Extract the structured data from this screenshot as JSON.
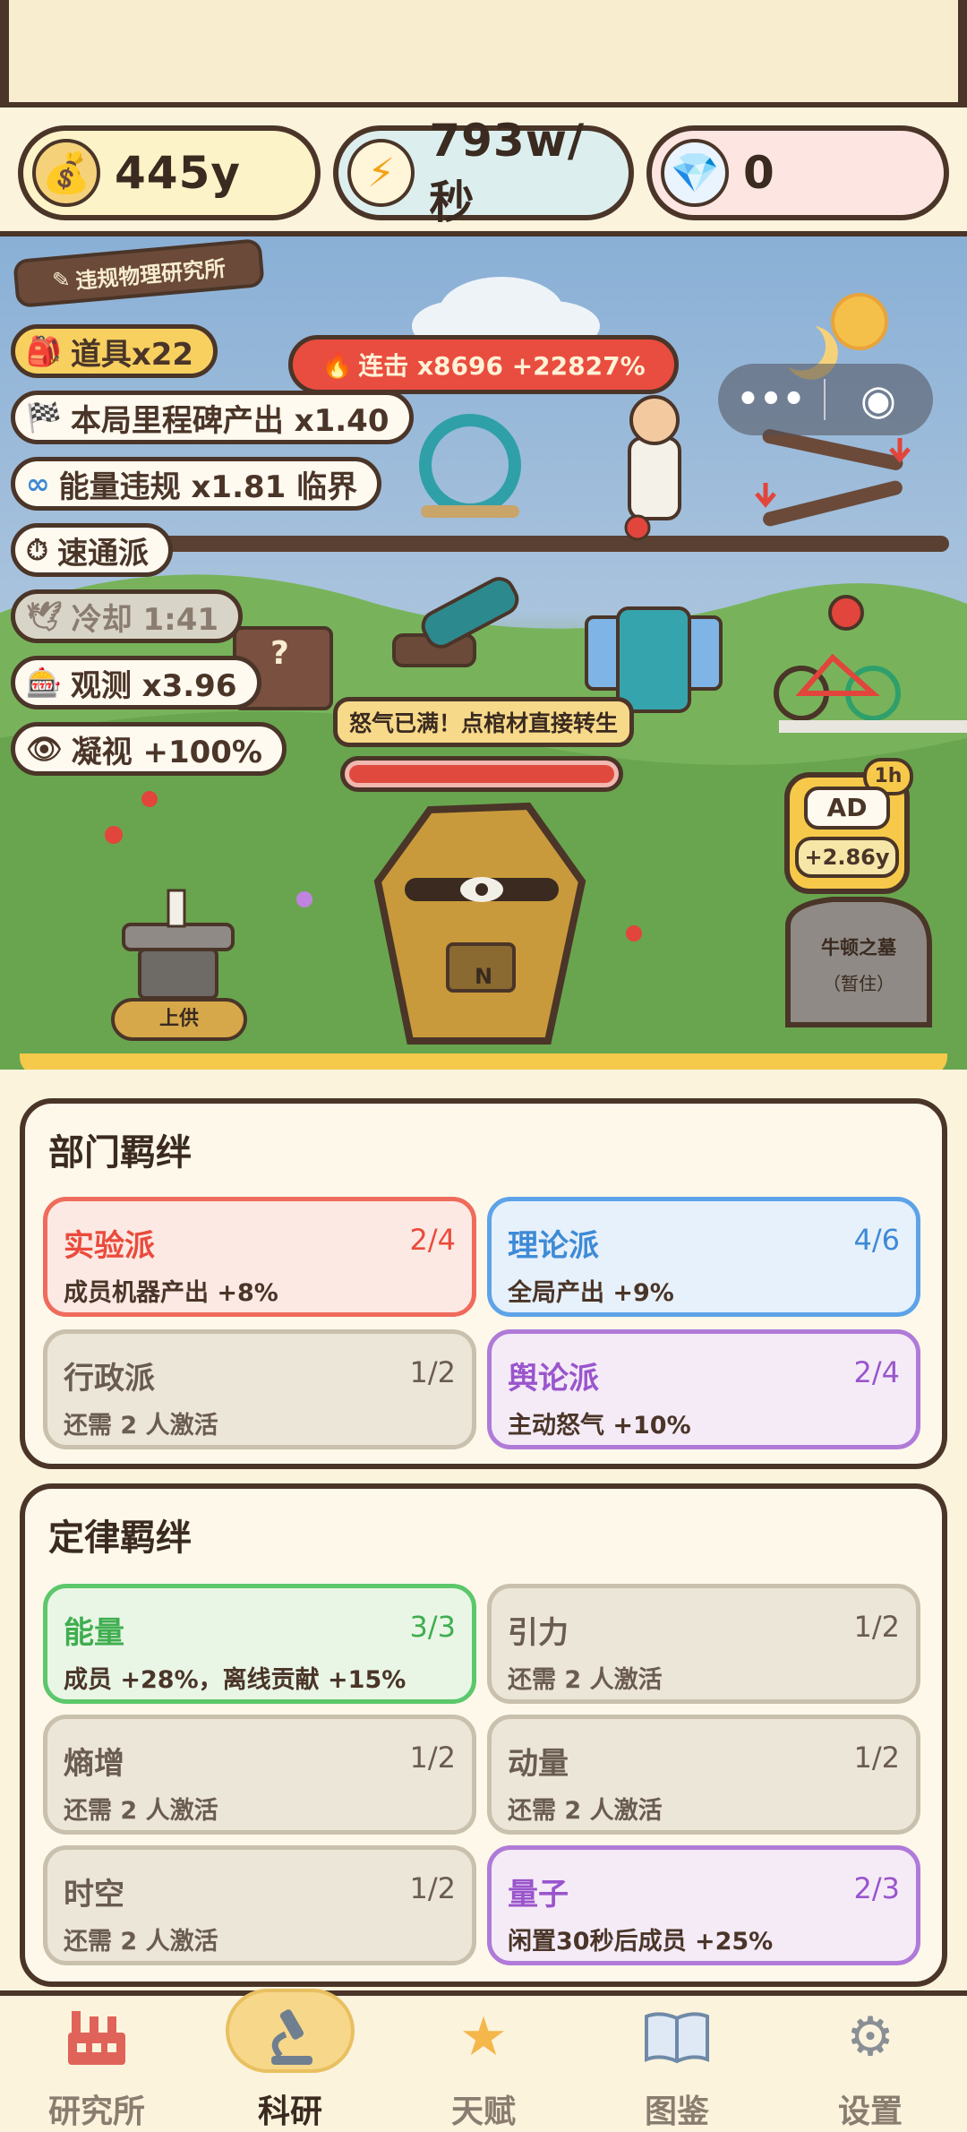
{
  "currency": {
    "money": "445y",
    "energy": "793w/秒",
    "gems": "0"
  },
  "scene": {
    "lab_sign": "违规物理研究所",
    "combo_text": "连击 x8696 +22827%",
    "rage_text": "怒气已满！点棺材直接转生",
    "coffin_letter": "N",
    "ad_label": "AD",
    "ad_timer": "1h",
    "ad_reward": "+2.86y",
    "offer_button": "上供",
    "tomb_name": "牛顿之墓",
    "tomb_status": "（暂住）",
    "question_mark": "?",
    "tags": [
      {
        "icon": "backpack-icon",
        "text": "道具x22"
      },
      {
        "icon": "checkered-flag-icon",
        "text": "本局里程碑产出 x1.40"
      },
      {
        "icon": "infinity-icon",
        "text": "能量违规 x1.81 临界"
      },
      {
        "icon": "stopwatch-icon",
        "text": "速通派"
      },
      {
        "icon": "dove-icon",
        "text": "冷却 1:41"
      },
      {
        "icon": "slot-machine-icon",
        "text": "观测 x3.96"
      },
      {
        "icon": "eye-icon",
        "text": "凝视 +100%"
      }
    ]
  },
  "department_bonds": {
    "title": "部门羁绊",
    "cards": [
      {
        "name": "实验派",
        "count": "2/4",
        "desc": "成员机器产出 +8%",
        "color": "#ea4b3c"
      },
      {
        "name": "理论派",
        "count": "4/6",
        "desc": "全局产出 +9%",
        "color": "#3e8ad6"
      },
      {
        "name": "行政派",
        "count": "1/2",
        "desc": "还需 2 人激活",
        "color": "#6a5c50"
      },
      {
        "name": "舆论派",
        "count": "2/4",
        "desc": "主动怒气 +10%",
        "color": "#9a55cc"
      }
    ]
  },
  "law_bonds": {
    "title": "定律羁绊",
    "cards": [
      {
        "name": "能量",
        "count": "3/3",
        "desc": "成员 +28%，离线贡献 +15%",
        "color": "#3fae4f"
      },
      {
        "name": "引力",
        "count": "1/2",
        "desc": "还需 2 人激活",
        "color": "#6a5c50"
      },
      {
        "name": "熵增",
        "count": "1/2",
        "desc": "还需 2 人激活",
        "color": "#6a5c50"
      },
      {
        "name": "动量",
        "count": "1/2",
        "desc": "还需 2 人激活",
        "color": "#6a5c50"
      },
      {
        "name": "时空",
        "count": "1/2",
        "desc": "还需 2 人激活",
        "color": "#6a5c50"
      },
      {
        "name": "量子",
        "count": "2/3",
        "desc": "闲置30秒后成员 +25%",
        "color": "#9a55cc"
      }
    ]
  },
  "nav": {
    "items": [
      {
        "label": "研究所",
        "icon": "factory-icon"
      },
      {
        "label": "科研",
        "icon": "microscope-icon"
      },
      {
        "label": "天赋",
        "icon": "star-icon"
      },
      {
        "label": "图鉴",
        "icon": "book-icon"
      },
      {
        "label": "设置",
        "icon": "gear-icon"
      }
    ],
    "active": "科研"
  },
  "colors": {
    "outline": "#4a3528",
    "money_pill": "#fdf3c8",
    "energy_pill": "#dcefee",
    "gem_pill": "#fde6e2",
    "rage_red": "#e94d3f",
    "nav_active": "#f7d78a"
  }
}
